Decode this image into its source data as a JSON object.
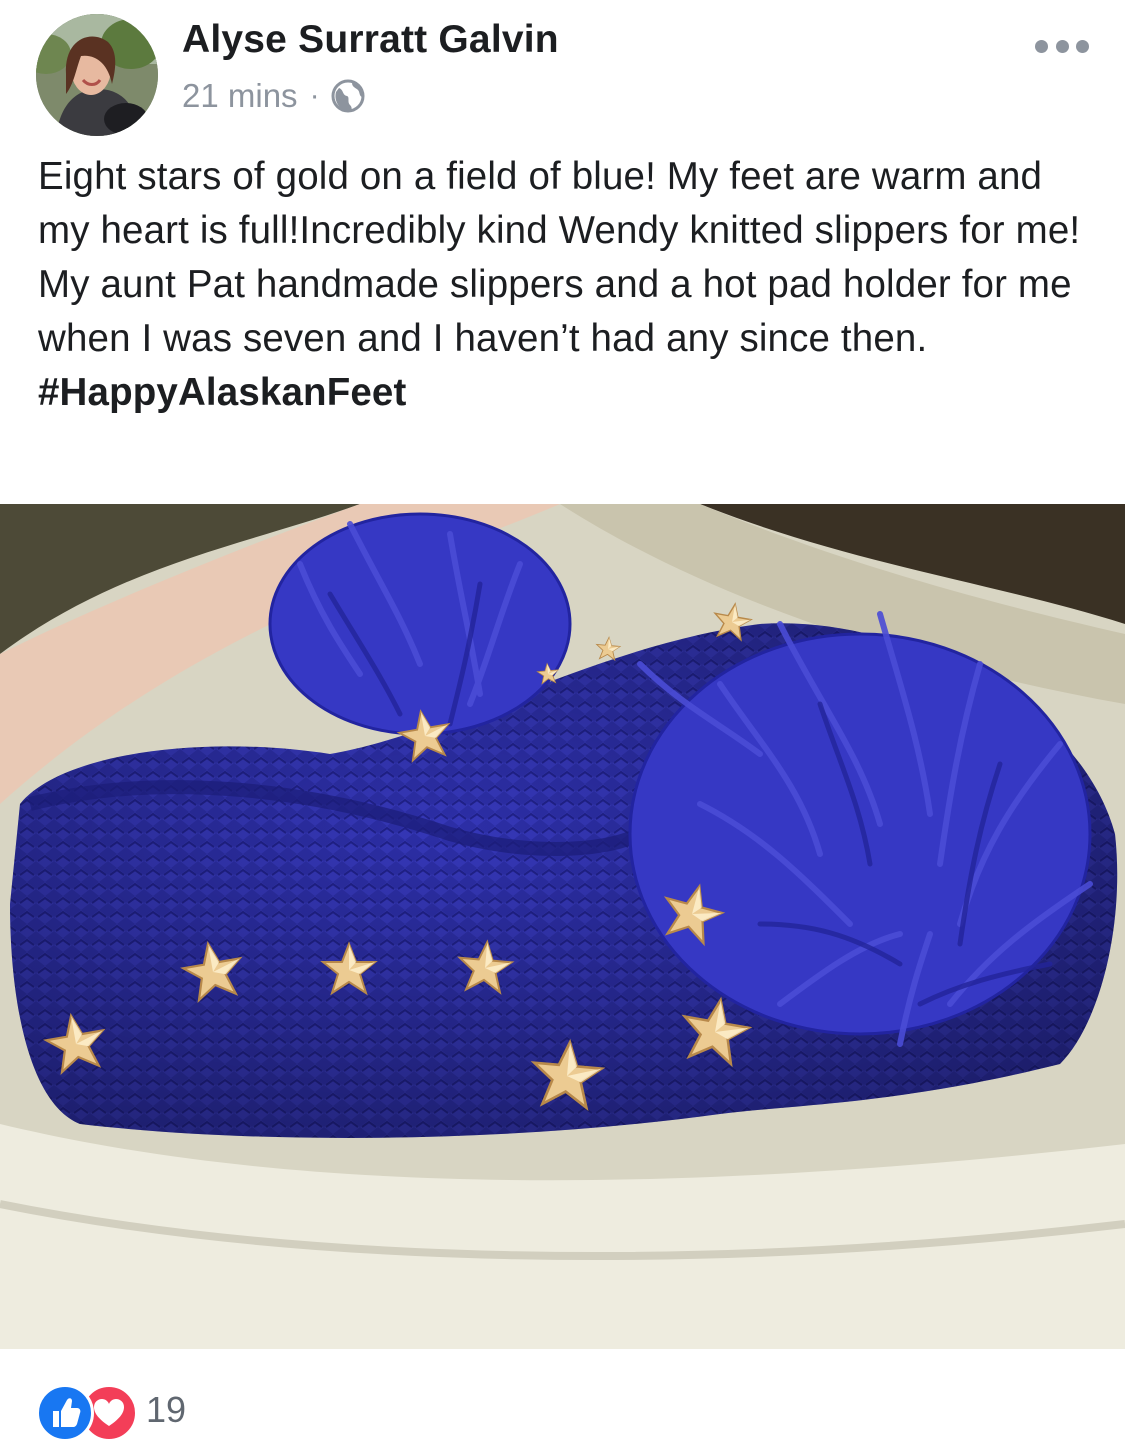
{
  "post": {
    "author": "Alyse Surratt Galvin",
    "timestamp": "21 mins",
    "separator": "·",
    "privacy_icon": "globe-icon",
    "more_icon": "more-options-icon",
    "avatar_alt": "profile photo",
    "text_lines": [
      "Eight stars of gold on a field of blue! My feet are warm and my heart is full!Incredibly kind Wendy knitted slippers for me!",
      "My aunt Pat handmade slippers and a hot pad holder for me when I was seven and I haven’t had any since then."
    ],
    "hashtag": "#HappyAlaskanFeet",
    "photo_description_icon": "knitted-slippers-photo",
    "reactions": {
      "icons": [
        "like-icon",
        "love-icon"
      ],
      "count": "19"
    }
  },
  "colors": {
    "like": "#1877f2",
    "love": "#f33e58",
    "meta_gray": "#8d949e",
    "slipper_blue": "#2d2fa8",
    "star_gold": "#e9c98a"
  }
}
